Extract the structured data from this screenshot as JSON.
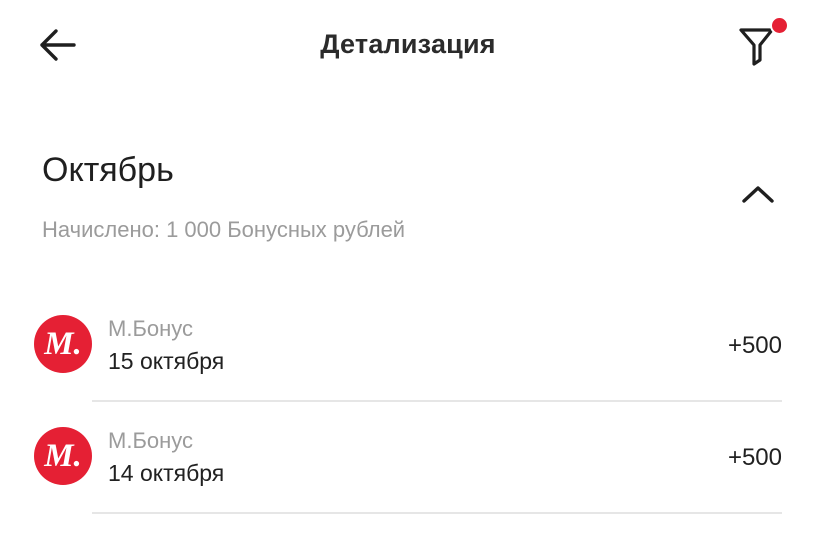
{
  "header": {
    "title": "Детализация",
    "back_icon": "arrow-left-icon",
    "filter_icon": "filter-icon",
    "filter_active": true,
    "accent_color": "#e52034"
  },
  "month": {
    "title": "Октябрь",
    "summary": "Начислено: 1 000 Бонусных рублей",
    "expanded": true,
    "toggle_icon": "chevron-up-icon"
  },
  "transactions": [
    {
      "logo_text": "М.",
      "source": "М.Бонус",
      "date": "15 октября",
      "amount": "+500"
    },
    {
      "logo_text": "М.",
      "source": "М.Бонус",
      "date": "14 октября",
      "amount": "+500"
    }
  ]
}
